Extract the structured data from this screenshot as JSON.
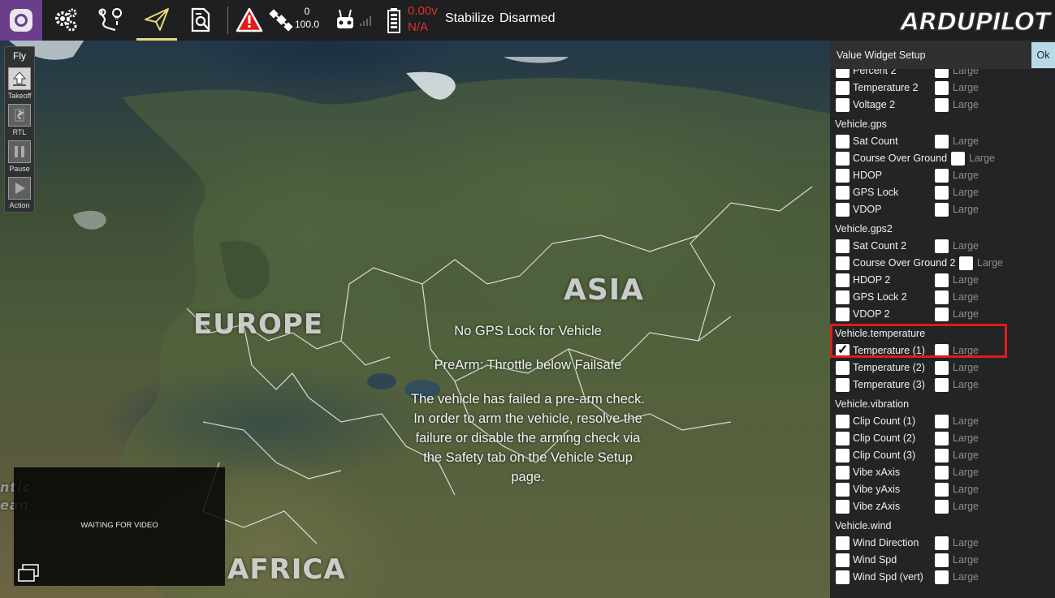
{
  "toolbar": {
    "gps_sat_count": "0",
    "gps_hdop": "100.0",
    "battery_voltage": "0.00v",
    "battery_remaining": "N/A",
    "flight_mode": "Stabilize",
    "arm_state": "Disarmed",
    "brand": "ARDUPILOT",
    "icons": [
      "qgc-logo-icon",
      "settings-gears-icon",
      "plan-route-icon",
      "fly-paper-plane-icon",
      "analyze-document-icon",
      "warning-icon",
      "satellite-icon",
      "rc-transmitter-icon",
      "signal-bars-icon",
      "battery-icon"
    ]
  },
  "map": {
    "labels": {
      "europe": "EUROPE",
      "asia": "ASIA",
      "africa": "AFRICA",
      "atlantic": "ntic\nean"
    }
  },
  "messages": [
    "No GPS Lock for Vehicle",
    "PreArm: Throttle below Failsafe",
    "The vehicle has failed a pre-arm check. In order to arm the vehicle, resolve the failure or disable the arming check via the Safety tab on the Vehicle Setup page."
  ],
  "fly_tools": {
    "title": "Fly",
    "items": [
      {
        "label": "Takeoff",
        "icon": "takeoff-arrow-icon"
      },
      {
        "label": "RTL",
        "icon": "rtl-return-icon"
      },
      {
        "label": "Pause",
        "icon": "pause-icon"
      },
      {
        "label": "Action",
        "icon": "play-action-icon"
      }
    ]
  },
  "video": {
    "status": "WAITING FOR VIDEO"
  },
  "panel": {
    "title": "Value Widget Setup",
    "ok_label": "Ok",
    "large_label": "Large",
    "top_rows": [
      {
        "name": "Percent 2",
        "checked": false
      },
      {
        "name": "Temperature 2",
        "checked": false
      },
      {
        "name": "Voltage 2",
        "checked": false
      }
    ],
    "groups": [
      {
        "title": "Vehicle.gps",
        "rows": [
          {
            "name": "Sat Count",
            "checked": false
          },
          {
            "name": "Course Over Ground",
            "checked": false
          },
          {
            "name": "HDOP",
            "checked": false
          },
          {
            "name": "GPS Lock",
            "checked": false
          },
          {
            "name": "VDOP",
            "checked": false
          }
        ]
      },
      {
        "title": "Vehicle.gps2",
        "rows": [
          {
            "name": "Sat Count 2",
            "checked": false
          },
          {
            "name": "Course Over Ground 2",
            "checked": false
          },
          {
            "name": "HDOP 2",
            "checked": false
          },
          {
            "name": "GPS Lock 2",
            "checked": false
          },
          {
            "name": "VDOP 2",
            "checked": false
          }
        ]
      },
      {
        "title": "Vehicle.temperature",
        "highlighted": true,
        "rows": [
          {
            "name": "Temperature (1)",
            "checked": true
          },
          {
            "name": "Temperature (2)",
            "checked": false
          },
          {
            "name": "Temperature (3)",
            "checked": false
          }
        ]
      },
      {
        "title": "Vehicle.vibration",
        "rows": [
          {
            "name": "Clip Count (1)",
            "checked": false
          },
          {
            "name": "Clip Count (2)",
            "checked": false
          },
          {
            "name": "Clip Count (3)",
            "checked": false
          },
          {
            "name": "Vibe xAxis",
            "checked": false
          },
          {
            "name": "Vibe yAxis",
            "checked": false
          },
          {
            "name": "Vibe zAxis",
            "checked": false
          }
        ]
      },
      {
        "title": "Vehicle.wind",
        "rows": [
          {
            "name": "Wind Direction",
            "checked": false
          },
          {
            "name": "Wind Spd",
            "checked": false
          },
          {
            "name": "Wind Spd (vert)",
            "checked": false
          }
        ]
      }
    ]
  },
  "colors": {
    "accent_purple": "#6a3e8a",
    "alert_red": "#e23131",
    "highlight_red": "#e01b1b",
    "ok_button": "#b7dbe6",
    "fly_tab_underline": "#e9d77c"
  }
}
